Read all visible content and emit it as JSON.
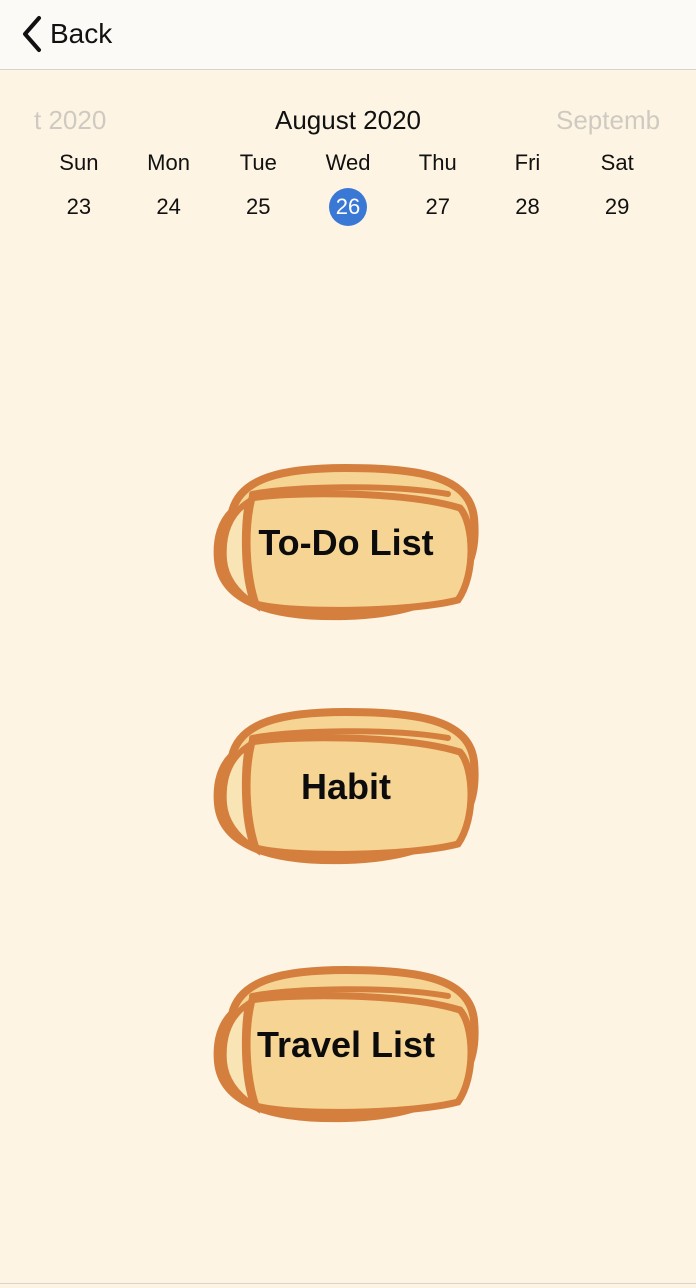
{
  "navbar": {
    "back_label": "Back",
    "back_icon": "chevron-left-icon"
  },
  "calendar": {
    "prev_month": "t 2020",
    "current_month": "August 2020",
    "next_month": "Septemb",
    "weekdays": [
      "Sun",
      "Mon",
      "Tue",
      "Wed",
      "Thu",
      "Fri",
      "Sat"
    ],
    "dates": [
      "23",
      "24",
      "25",
      "26",
      "27",
      "28",
      "29"
    ],
    "selected_date": "26",
    "selected_color": "#3a78d6"
  },
  "menu": {
    "todo_label": "To-Do List",
    "habit_label": "Habit",
    "travel_label": "Travel List",
    "button_fill": "#f6d594",
    "button_stroke": "#d57f3f"
  },
  "colors": {
    "background": "#fdf4e3"
  }
}
